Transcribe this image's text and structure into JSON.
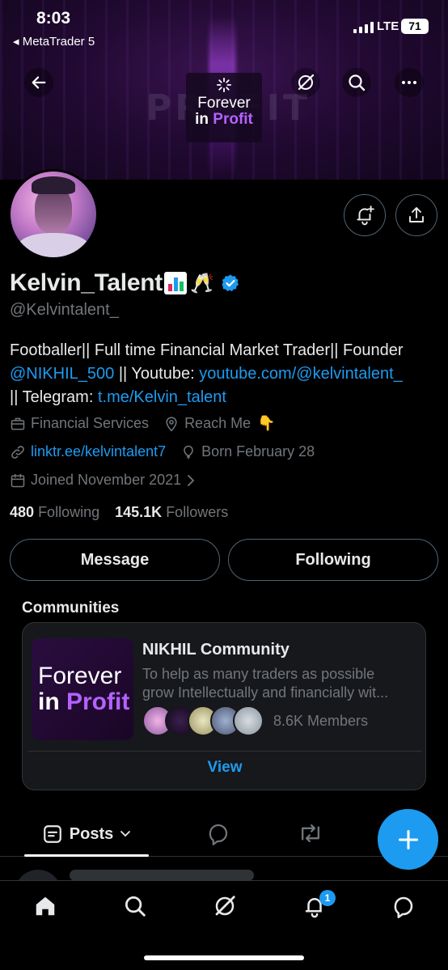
{
  "status": {
    "time": "8:03",
    "back_app": "◂ MetaTrader 5",
    "network": "LTE",
    "battery": "71"
  },
  "banner": {
    "big_word": "PROFIT",
    "logo_line1": "Forever",
    "logo_line2a": "in ",
    "logo_line2b": "Profit"
  },
  "profile": {
    "name": "Kelvin_Talent",
    "name_emoji": "🥂",
    "handle": "@Kelvintalent_",
    "bio_text1": "Footballer|| Full time Financial Market Trader|| Founder ",
    "bio_link1": "@NIKHIL_500",
    "bio_text2": " || Youtube: ",
    "bio_link2": "youtube.com/@kelvintalent_",
    "bio_text3": "|| Telegram: ",
    "bio_link3": "t.me/Kelvin_talent",
    "category": "Financial Services",
    "location": "Reach Me",
    "location_emoji": "👇",
    "website": "linktr.ee/kelvintalent7",
    "birthday": "Born February 28",
    "joined": "Joined November 2021",
    "following_count": "480",
    "following_label": "Following",
    "followers_count": "145.1K",
    "followers_label": "Followers"
  },
  "actions": {
    "message": "Message",
    "following": "Following"
  },
  "communities": {
    "title": "Communities",
    "card_name": "NIKHIL Community",
    "card_desc_line1": "To help as many traders as possible",
    "card_desc_line2": "grow Intellectually and financially wit...",
    "members": "8.6K Members",
    "view": "View",
    "img_line1": "Forever",
    "img_line2a": "in ",
    "img_line2b": "Profit"
  },
  "tabs": {
    "posts": "Posts"
  },
  "bottom_nav": {
    "notification_badge": "1"
  },
  "colors": {
    "accent": "#1d9bf0",
    "background": "#000000",
    "muted": "#71767b",
    "brand_purple": "#b462ff"
  }
}
